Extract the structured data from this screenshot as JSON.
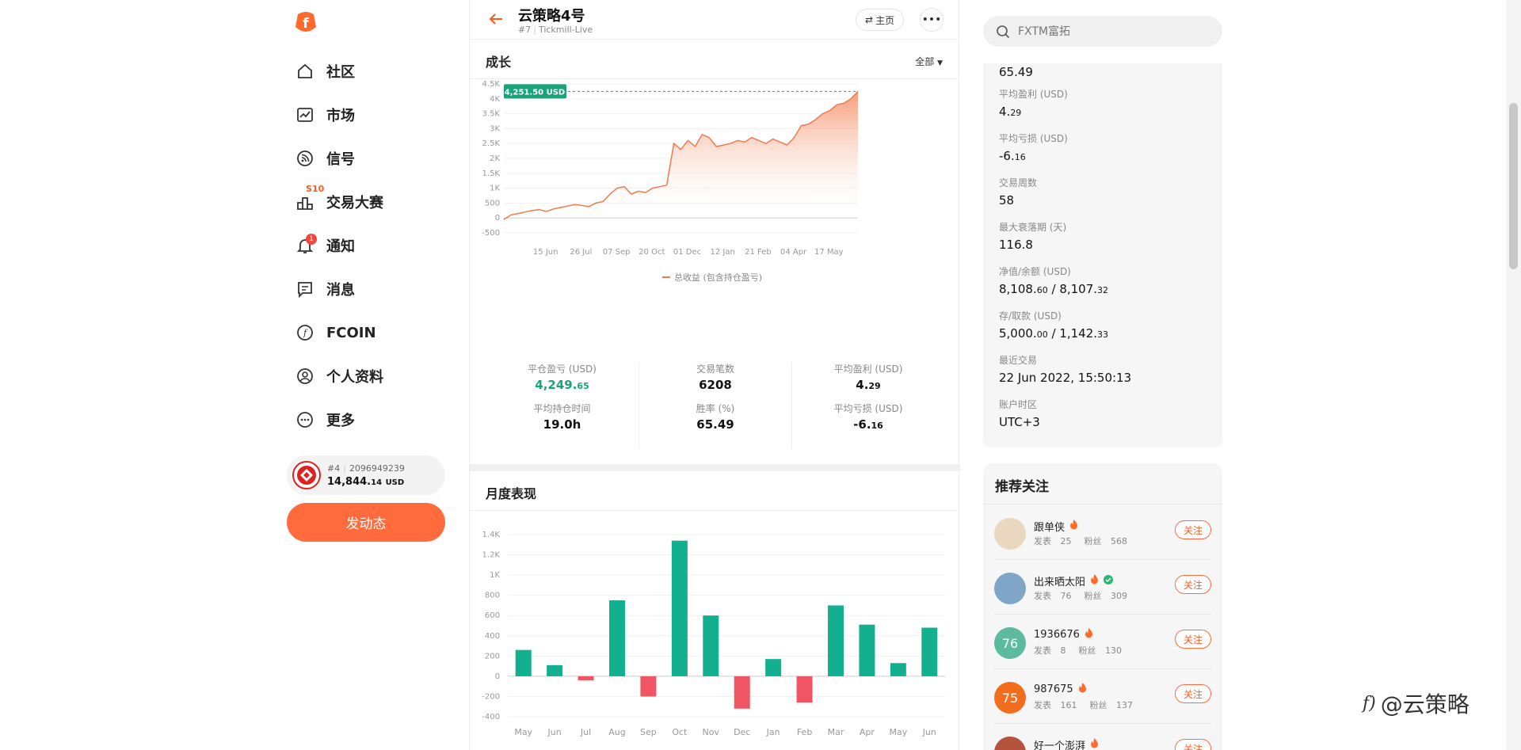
{
  "sidebar": {
    "items": [
      {
        "label": "社区",
        "icon": "home-icon"
      },
      {
        "label": "市场",
        "icon": "chart-line-icon"
      },
      {
        "label": "信号",
        "icon": "rss-icon"
      },
      {
        "label": "交易大赛",
        "icon": "podium-icon",
        "badge": "S10"
      },
      {
        "label": "通知",
        "icon": "bell-icon",
        "badge": "1"
      },
      {
        "label": "消息",
        "icon": "message-icon"
      },
      {
        "label": "FCOIN",
        "icon": "fcoin-icon"
      },
      {
        "label": "个人资料",
        "icon": "user-icon"
      },
      {
        "label": "更多",
        "icon": "more-icon"
      }
    ],
    "account": {
      "rank": "#4",
      "id": "2096949239",
      "balance": "14,844.",
      "balance_dec": "14",
      "currency": "USD"
    },
    "post_button": "发动态"
  },
  "header": {
    "title": "云策略4号",
    "rank": "#7",
    "server": "Tickmill-Live",
    "home_button": "主页",
    "more_button": "•••"
  },
  "growth": {
    "title": "成长",
    "range": "全部",
    "legend": "总收益 (包含持仓盈亏)"
  },
  "stats": {
    "closed_pl_label": "平仓盈亏 (USD)",
    "closed_pl": "4,249.",
    "closed_pl_dec": "65",
    "trades_label": "交易笔数",
    "trades": "6208",
    "avg_profit_label": "平均盈利 (USD)",
    "avg_profit": "4.",
    "avg_profit_dec": "29",
    "hold_label": "平均持仓时间",
    "hold": "19.0h",
    "winrate_label": "胜率 (%)",
    "winrate": "65.49",
    "avg_loss_label": "平均亏损 (USD)",
    "avg_loss": "-6.",
    "avg_loss_dec": "16"
  },
  "monthly": {
    "title": "月度表现"
  },
  "search": {
    "placeholder": "FXTM富拓"
  },
  "info": {
    "winrate_value": "65.49",
    "avg_profit_label": "平均盈利 (USD)",
    "avg_profit": "4.",
    "avg_profit_dec": "29",
    "avg_loss_label": "平均亏损 (USD)",
    "avg_loss": "-6.",
    "avg_loss_dec": "16",
    "weeks_label": "交易周数",
    "weeks": "58",
    "drawdown_label": "最大衰落期 (天)",
    "drawdown": "116.8",
    "equity_label": "净值/余额 (USD)",
    "equity": "8,108.",
    "equity_dec": "60",
    "balance": "8,107.",
    "balance_dec": "32",
    "deposit_label": "存/取款 (USD)",
    "deposit": "5,000.",
    "deposit_dec": "00",
    "withdraw": "1,142.",
    "withdraw_dec": "33",
    "last_trade_label": "最近交易",
    "last_trade": "22 Jun 2022, 15:50:13",
    "timezone_label": "账户时区",
    "timezone": "UTC+3"
  },
  "recommend": {
    "title": "推荐关注",
    "follow_label": "关注",
    "posts_label": "发表",
    "fans_label": "粉丝",
    "users": [
      {
        "name": "跟单侠",
        "posts": "25",
        "fans": "568",
        "avatar_text": "",
        "avatar_color": "#e9d7c0"
      },
      {
        "name": "出来晒太阳",
        "posts": "76",
        "fans": "309",
        "avatar_text": "",
        "avatar_color": "#7fa6c7"
      },
      {
        "name": "1936676",
        "posts": "8",
        "fans": "130",
        "avatar_text": "76",
        "avatar_color": "#5dbb9d"
      },
      {
        "name": "987675",
        "posts": "161",
        "fans": "137",
        "avatar_text": "75",
        "avatar_color": "#f36d1f"
      },
      {
        "name": "好一个澎湃",
        "posts": "",
        "fans": "",
        "avatar_text": "",
        "avatar_color": "#b5533e"
      }
    ]
  },
  "watermark": "@云策略",
  "chart_data": [
    {
      "type": "area",
      "title": "成长",
      "series": [
        {
          "name": "总收益 (包含持仓盈亏)",
          "color": "#f07a4f"
        }
      ],
      "x_ticks": [
        "15 Jun",
        "26 Jul",
        "07 Sep",
        "20 Oct",
        "01 Dec",
        "12 Jan",
        "21 Feb",
        "04 Apr",
        "17 May"
      ],
      "y_ticks": [
        "4.5K",
        "4K",
        "3.5K",
        "3K",
        "2.5K",
        "2K",
        "1.5K",
        "1K",
        "500",
        "0",
        "-500"
      ],
      "ylim": [
        -500,
        4500
      ],
      "current_value_label": "4,251.50 USD",
      "current_value": 4251.5,
      "points": [
        [
          0,
          -50
        ],
        [
          0.02,
          100
        ],
        [
          0.04,
          150
        ],
        [
          0.06,
          200
        ],
        [
          0.08,
          250
        ],
        [
          0.1,
          280
        ],
        [
          0.12,
          220
        ],
        [
          0.14,
          300
        ],
        [
          0.16,
          350
        ],
        [
          0.18,
          400
        ],
        [
          0.2,
          450
        ],
        [
          0.22,
          420
        ],
        [
          0.24,
          380
        ],
        [
          0.26,
          500
        ],
        [
          0.28,
          550
        ],
        [
          0.3,
          800
        ],
        [
          0.32,
          1000
        ],
        [
          0.34,
          1050
        ],
        [
          0.36,
          800
        ],
        [
          0.38,
          900
        ],
        [
          0.4,
          850
        ],
        [
          0.42,
          1000
        ],
        [
          0.44,
          1050
        ],
        [
          0.46,
          1100
        ],
        [
          0.48,
          2500
        ],
        [
          0.5,
          2300
        ],
        [
          0.52,
          2600
        ],
        [
          0.54,
          2400
        ],
        [
          0.56,
          2800
        ],
        [
          0.58,
          2700
        ],
        [
          0.6,
          2400
        ],
        [
          0.62,
          2450
        ],
        [
          0.64,
          2500
        ],
        [
          0.66,
          2600
        ],
        [
          0.68,
          2550
        ],
        [
          0.7,
          2700
        ],
        [
          0.72,
          2600
        ],
        [
          0.74,
          2500
        ],
        [
          0.76,
          2650
        ],
        [
          0.78,
          2550
        ],
        [
          0.8,
          2450
        ],
        [
          0.82,
          2700
        ],
        [
          0.84,
          3100
        ],
        [
          0.86,
          3150
        ],
        [
          0.88,
          3300
        ],
        [
          0.9,
          3500
        ],
        [
          0.92,
          3600
        ],
        [
          0.94,
          3800
        ],
        [
          0.96,
          3850
        ],
        [
          0.98,
          4000
        ],
        [
          1.0,
          4251.5
        ]
      ]
    },
    {
      "type": "bar",
      "title": "月度表现",
      "categories": [
        "May",
        "Jun",
        "Jul",
        "Aug",
        "Sep",
        "Oct",
        "Nov",
        "Dec",
        "Jan",
        "Feb",
        "Mar",
        "Apr",
        "May",
        "Jun"
      ],
      "values": [
        260,
        110,
        -40,
        750,
        -200,
        1340,
        600,
        -320,
        170,
        -260,
        700,
        510,
        130,
        480
      ],
      "y_ticks": [
        "1.4K",
        "1.2K",
        "1K",
        "800",
        "600",
        "400",
        "200",
        "0",
        "-200",
        "-400"
      ],
      "ylim": [
        -400,
        1400
      ],
      "positive_color": "#12b08e",
      "negative_color": "#ef5562"
    }
  ]
}
